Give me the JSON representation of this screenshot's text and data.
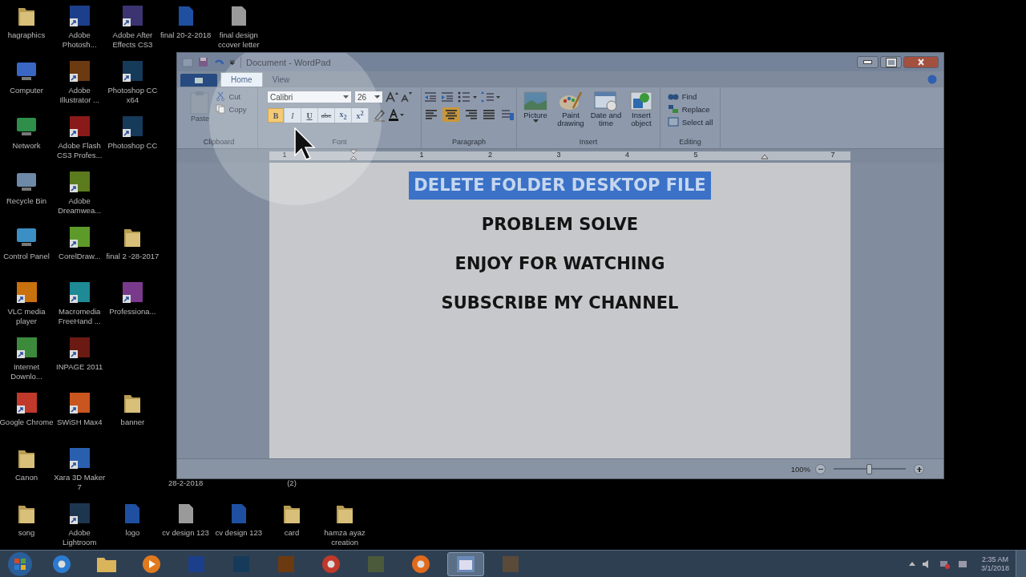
{
  "desktop_icons": [
    {
      "label": "hagraphics",
      "kind": "folder"
    },
    {
      "label": "Adobe Photosh...",
      "kind": "app",
      "color": "#1c3f8c"
    },
    {
      "label": "Adobe After Effects CS3",
      "kind": "app",
      "color": "#3b3470"
    },
    {
      "label": "final 20-2-2018",
      "kind": "file",
      "color": "#1f4fa0"
    },
    {
      "label": "final design ccover letter",
      "kind": "file",
      "color": "#9a9a9a"
    },
    {
      "label": "Computer",
      "kind": "system",
      "color": "#3a66c4"
    },
    {
      "label": "Adobe Illustrator ...",
      "kind": "app",
      "color": "#6b3a10"
    },
    {
      "label": "Photoshop CC x64",
      "kind": "app",
      "color": "#163a5a"
    },
    {
      "label": "Network",
      "kind": "system",
      "color": "#2f8f4a"
    },
    {
      "label": "Adobe Flash CS3 Profes...",
      "kind": "app",
      "color": "#8a1a1a"
    },
    {
      "label": "Photoshop CC",
      "kind": "app",
      "color": "#163a5a"
    },
    {
      "label": "Recycle Bin",
      "kind": "system",
      "color": "#6d8aa8"
    },
    {
      "label": "Adobe Dreamwea...",
      "kind": "app",
      "color": "#5c7a1e"
    },
    {
      "label": "Control Panel",
      "kind": "system",
      "color": "#3b8fc4"
    },
    {
      "label": "CorelDraw...",
      "kind": "app",
      "color": "#5e9a2a"
    },
    {
      "label": "final 2 -28-2017",
      "kind": "folder"
    },
    {
      "label": "VLC media player",
      "kind": "app",
      "color": "#c9700f"
    },
    {
      "label": "Macromedia FreeHand ...",
      "kind": "app",
      "color": "#1d8a95"
    },
    {
      "label": "Professiona...",
      "kind": "app",
      "color": "#7a3a8c"
    },
    {
      "label": "Internet Downlo...",
      "kind": "app",
      "color": "#3c8a3c"
    },
    {
      "label": "INPAGE 2011",
      "kind": "app",
      "color": "#6a1a12"
    },
    {
      "label": "Google Chrome",
      "kind": "app",
      "color": "#c0392b"
    },
    {
      "label": "SWiSH Max4",
      "kind": "app",
      "color": "#c8561e"
    },
    {
      "label": "banner",
      "kind": "folder"
    },
    {
      "label": "Canon",
      "kind": "folder"
    },
    {
      "label": "Xara 3D Maker 7",
      "kind": "app",
      "color": "#2a5fb0"
    },
    {
      "label": "song",
      "kind": "folder"
    },
    {
      "label": "Adobe Lightroom",
      "kind": "app",
      "color": "#1e3550"
    },
    {
      "label": "logo",
      "kind": "file",
      "color": "#1f4fa0"
    },
    {
      "label": "cv design 123",
      "kind": "file",
      "color": "#9a9a9a"
    },
    {
      "label": "cv design 123",
      "kind": "file",
      "color": "#1f4fa0"
    },
    {
      "label": "card",
      "kind": "folder"
    },
    {
      "label": "hamza ayaz creation",
      "kind": "folder"
    }
  ],
  "desktop_hidden_icon_labels": [
    "28-2-2018",
    "(2)"
  ],
  "window": {
    "title": "Document - WordPad",
    "tabs": [
      {
        "label": "Home",
        "selected": true
      },
      {
        "label": "View",
        "selected": false
      }
    ],
    "clipboard": {
      "paste": "Paste",
      "paste_disabled": true,
      "cut": "Cut",
      "copy": "Copy",
      "label": "Clipboard"
    },
    "font": {
      "family": "Calibri",
      "size": "26",
      "label": "Font",
      "format_buttons": [
        {
          "label": "B",
          "kind": "bold",
          "selected": true
        },
        {
          "label": "I",
          "kind": "italic",
          "selected": false
        },
        {
          "label": "U",
          "kind": "underline",
          "selected": false
        },
        {
          "label": "abc",
          "kind": "strike",
          "selected": false
        },
        {
          "label": "x$_{2}$",
          "kind": "subscript",
          "selected": false
        },
        {
          "label": "x$^{2}$",
          "kind": "superscript",
          "selected": false
        }
      ]
    },
    "paragraph": {
      "label": "Paragraph",
      "alignment_buttons": [
        {
          "kind": "left",
          "selected": false
        },
        {
          "kind": "center",
          "selected": true
        },
        {
          "kind": "right",
          "selected": false
        },
        {
          "kind": "justify",
          "selected": false
        }
      ]
    },
    "insert": {
      "label": "Insert",
      "items": [
        {
          "label": "Picture",
          "kind": "picture"
        },
        {
          "label": "Paint drawing",
          "kind": "paint"
        },
        {
          "label": "Date and time",
          "kind": "calendar"
        },
        {
          "label": "Insert object",
          "kind": "object"
        }
      ]
    },
    "editing": {
      "label": "Editing",
      "items": [
        {
          "label": "Find",
          "kind": "find"
        },
        {
          "label": "Replace",
          "kind": "replace"
        },
        {
          "label": "Select all",
          "kind": "select"
        }
      ]
    },
    "ruler": [
      "1",
      "1",
      "2",
      "3",
      "4",
      "5",
      "7"
    ],
    "document_lines": [
      {
        "text": "DELETE FOLDER DESKTOP FILE",
        "selected": true
      },
      {
        "text": "PROBLEM SOLVE",
        "selected": false
      },
      {
        "text": "ENJOY FOR WATCHING",
        "selected": false
      },
      {
        "text": "SUBSCRIBE MY CHANNEL",
        "selected": false
      }
    ],
    "status_bar": {
      "zoom": "100%",
      "level": 0.5
    }
  },
  "taskbar": {
    "items": [
      {
        "kind": "browser",
        "color": "#2b7bd0",
        "selected": false
      },
      {
        "kind": "folder",
        "color": "#d9b45a",
        "selected": false
      },
      {
        "kind": "media",
        "color": "#e07a1f",
        "selected": false
      },
      {
        "kind": "app",
        "color": "#1c3f8c",
        "selected": false
      },
      {
        "kind": "app",
        "color": "#163a5a",
        "selected": false
      },
      {
        "kind": "app",
        "color": "#6b3a10",
        "selected": false
      },
      {
        "kind": "browser",
        "color": "#c0392b",
        "selected": false
      },
      {
        "kind": "app",
        "color": "#4a5a3a",
        "selected": false
      },
      {
        "kind": "browser",
        "color": "#e06a1a",
        "selected": false
      },
      {
        "kind": "document",
        "color": "#6a8ab8",
        "selected": true
      },
      {
        "kind": "app",
        "color": "#5a4a3a",
        "selected": false
      }
    ],
    "time": "2:35 AM",
    "date": "3/1/2018"
  }
}
